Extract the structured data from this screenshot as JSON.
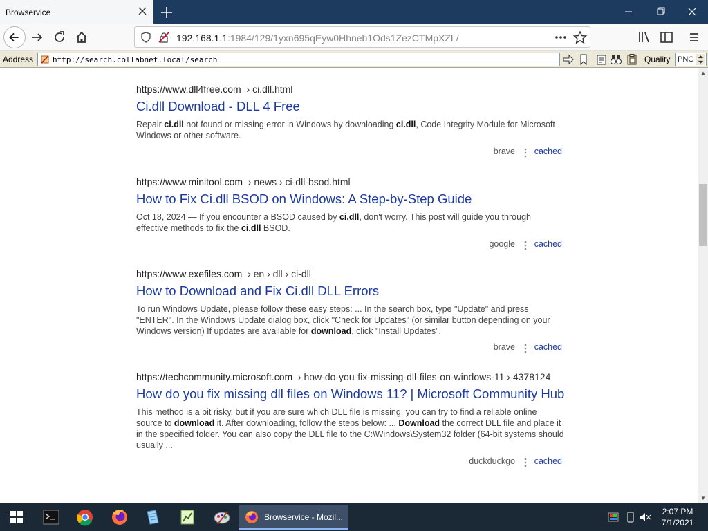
{
  "tab": {
    "title": "Browservice"
  },
  "nav": {
    "url_host": "192.168.1.1",
    "url_rest": ":1984/129/1yxn695qEyw0Hhneb1Ods1ZezCTMpXZL/"
  },
  "toolbar": {
    "address_label": "Address",
    "address_value": "http://search.collabnet.local/search",
    "quality_label": "Quality",
    "quality_value": "PNG"
  },
  "results": [
    {
      "url": "https://www.dll4free.com",
      "crumbs": "› ci.dll.html",
      "title": "Ci.dll Download - DLL 4 Free",
      "snippet": [
        {
          "t": "Repair ",
          "b": false
        },
        {
          "t": "ci.dll",
          "b": true
        },
        {
          "t": " not found or missing error in Windows by downloading ",
          "b": false
        },
        {
          "t": "ci.dll",
          "b": true
        },
        {
          "t": ", Code Integrity Module for Microsoft Windows or other software.",
          "b": false
        }
      ],
      "engine": "brave",
      "cached": "cached"
    },
    {
      "url": "https://www.minitool.com",
      "crumbs": "› news › ci-dll-bsod.html",
      "title": "How to Fix Ci.dll BSOD on Windows: A Step-by-Step Guide",
      "snippet": [
        {
          "t": "Oct 18, 2024 — If you encounter a BSOD caused by ",
          "b": false
        },
        {
          "t": "ci.dll",
          "b": true
        },
        {
          "t": ", don't worry. This post will guide you through effective methods to fix the ",
          "b": false
        },
        {
          "t": "ci.dll",
          "b": true
        },
        {
          "t": " BSOD.",
          "b": false
        }
      ],
      "engine": "google",
      "cached": "cached"
    },
    {
      "url": "https://www.exefiles.com",
      "crumbs": "› en › dll › ci-dll",
      "title": "How to Download and Fix Ci.dll DLL Errors",
      "snippet": [
        {
          "t": "To run Windows Update, please follow these easy steps: ... In the search box, type \"Update\" and press \"ENTER\". In the Windows Update dialog box, click \"Check for Updates\" (or similar button depending on your Windows version) If updates are available for ",
          "b": false
        },
        {
          "t": "download",
          "b": true
        },
        {
          "t": ", click \"Install Updates\".",
          "b": false
        }
      ],
      "engine": "brave",
      "cached": "cached"
    },
    {
      "url": "https://techcommunity.microsoft.com",
      "crumbs": "› how-do-you-fix-missing-dll-files-on-windows-11 › 4378124",
      "title": "How do you fix missing dll files on Windows 11? | Microsoft Community Hub",
      "snippet": [
        {
          "t": "This method is a bit risky, but if you are sure which DLL file is missing, you can try to find a reliable online source to ",
          "b": false
        },
        {
          "t": "download",
          "b": true
        },
        {
          "t": " it. After downloading, follow the steps below: ... ",
          "b": false
        },
        {
          "t": "Download",
          "b": true
        },
        {
          "t": " the correct DLL file and place it in the specified folder. You can also copy the DLL file to the C:\\Windows\\System32 folder (64-bit systems should usually ...",
          "b": false
        }
      ],
      "engine": "duckduckgo",
      "cached": "cached"
    }
  ],
  "scroll": {
    "thumb_fraction_top": 0.3
  },
  "taskbar": {
    "active_label": "Browservice - Mozil...",
    "time": "2:07 PM",
    "date": "7/1/2021"
  },
  "colors": {
    "link": "#1c3aa0",
    "tabbar": "#1d3a5f",
    "taskbar": "#1b2836"
  }
}
